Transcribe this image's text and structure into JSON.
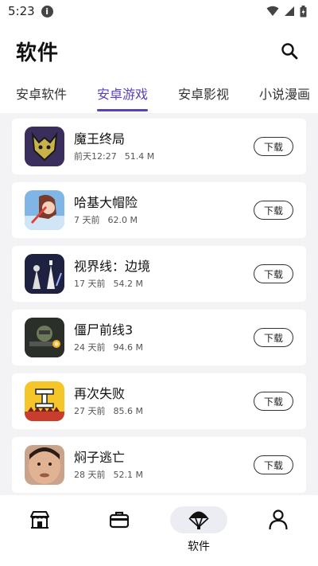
{
  "status_bar": {
    "time": "5:23",
    "info_icon": "info-icon",
    "icons": [
      "wifi-icon",
      "signal-icon",
      "battery-icon"
    ]
  },
  "header": {
    "title": "软件",
    "search_icon": "search-icon"
  },
  "tabs": [
    {
      "label": "安卓软件",
      "active": false
    },
    {
      "label": "安卓游戏",
      "active": true
    },
    {
      "label": "安卓影视",
      "active": false
    },
    {
      "label": "小说漫画",
      "active": false
    }
  ],
  "accent_color": "#5a3fc0",
  "apps": [
    {
      "name": "魔王终局",
      "time": "前天12:27",
      "size": "51.4 M",
      "button": "下载",
      "icon": "wolf-game-icon"
    },
    {
      "name": "哈基大帽险",
      "time": "7 天前",
      "size": "62.0 M",
      "button": "下载",
      "icon": "anime-girl-game-icon"
    },
    {
      "name": "视界线：边境",
      "time": "17 天前",
      "size": "54.2 M",
      "button": "下载",
      "icon": "horizon-chess-game-icon"
    },
    {
      "name": "僵尸前线3",
      "time": "24 天前",
      "size": "94.6 M",
      "button": "下载",
      "icon": "zombie-shooter-game-icon"
    },
    {
      "name": "再次失败",
      "time": "27 天前",
      "size": "85.6 M",
      "button": "下载",
      "icon": "fail-again-game-icon"
    },
    {
      "name": "焖子逃亡",
      "time": "28 天前",
      "size": "52.1 M",
      "button": "下载",
      "icon": "face-game-icon"
    }
  ],
  "bottom_nav": [
    {
      "icon": "market-stall-icon",
      "label": "",
      "active": false
    },
    {
      "icon": "briefcase-icon",
      "label": "",
      "active": false
    },
    {
      "icon": "parachute-icon",
      "label": "软件",
      "active": true
    },
    {
      "icon": "person-icon",
      "label": "",
      "active": false
    }
  ]
}
